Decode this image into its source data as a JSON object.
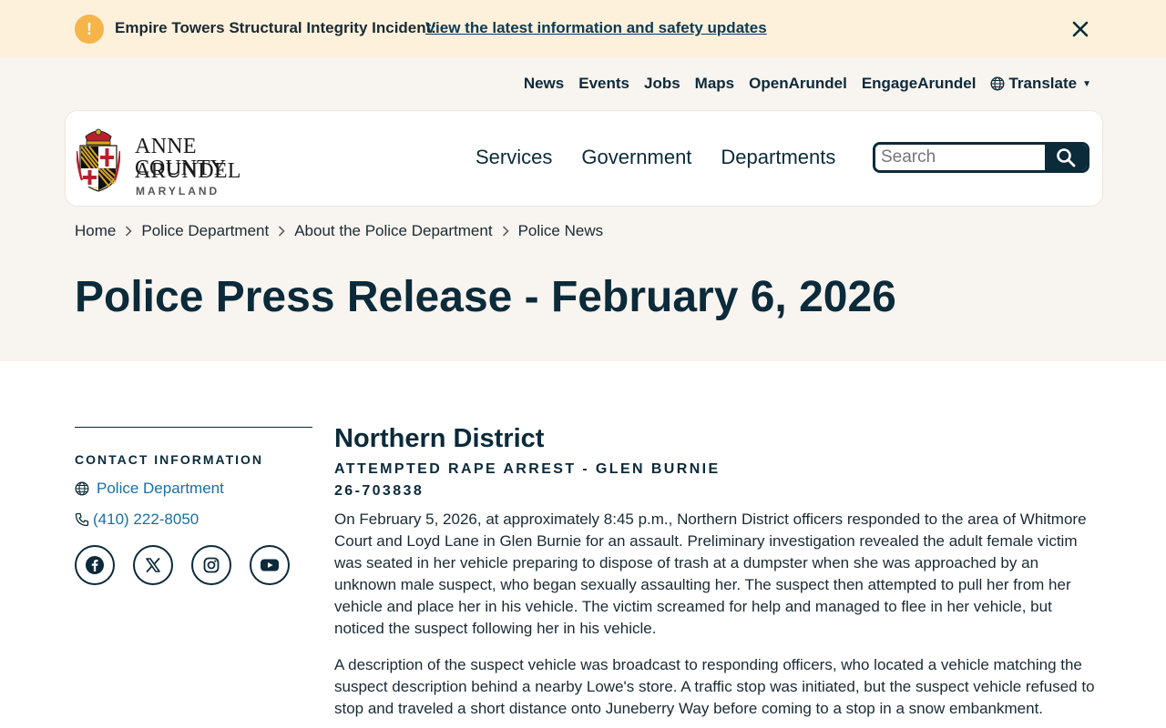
{
  "alert": {
    "icon": "exclamation-icon",
    "title": "Empire Towers Structural Integrity Incident:",
    "link": "View the latest information and safety updates",
    "close_icon": "close-icon",
    "color": "#f6b549"
  },
  "utility_nav": {
    "items": [
      "News",
      "Events",
      "Jobs",
      "Maps",
      "OpenArundel",
      "EngageArundel"
    ],
    "translate": "Translate"
  },
  "logo": {
    "line1": "ANNE ARUNDEL",
    "line2": "COUNTY",
    "line3": "MARYLAND"
  },
  "main_nav": {
    "items": [
      "Services",
      "Government",
      "Departments"
    ]
  },
  "search": {
    "placeholder": "Search",
    "value": ""
  },
  "breadcrumb": {
    "items": [
      "Home",
      "Police Department",
      "About the Police Department",
      "Police News"
    ]
  },
  "page": {
    "title": "Police Press Release - February 6, 2026"
  },
  "sidebar": {
    "heading": "CONTACT INFORMATION",
    "website": "Police Department",
    "phone": "(410) 222-8050",
    "social_icons": [
      "facebook-icon",
      "x-icon",
      "instagram-icon",
      "youtube-icon"
    ]
  },
  "article": {
    "district": "Northern District",
    "headline": "ATTEMPTED RAPE ARREST - GLEN BURNIE",
    "case_number": "26-703838",
    "paragraphs": [
      "On February 5, 2026, at approximately 8:45 p.m., Northern District officers responded to the area of Whitmore Court and Loyd Lane in Glen Burnie for an assault. Preliminary investigation revealed the adult female victim was seated in her vehicle preparing to dispose of trash at a dumpster when she was approached by an unknown male suspect, who began sexually assaulting her. The suspect then attempted to pull her from her vehicle and place her in his vehicle. The victim screamed for help and managed to flee in her vehicle, but noticed the suspect following her in his vehicle.",
      "A description of the suspect vehicle was broadcast to responding officers, who located a vehicle matching the suspect description behind a nearby Lowe's store. A traffic stop was initiated, but the suspect vehicle refused to stop and traveled a short distance onto Juneberry Way before coming to a stop in a snow embankment."
    ]
  },
  "colors": {
    "primary": "#0b2a3a",
    "link": "#1a6fa3",
    "alert_bg": "#fdf1dc",
    "header_bg": "#f8f4ef"
  }
}
